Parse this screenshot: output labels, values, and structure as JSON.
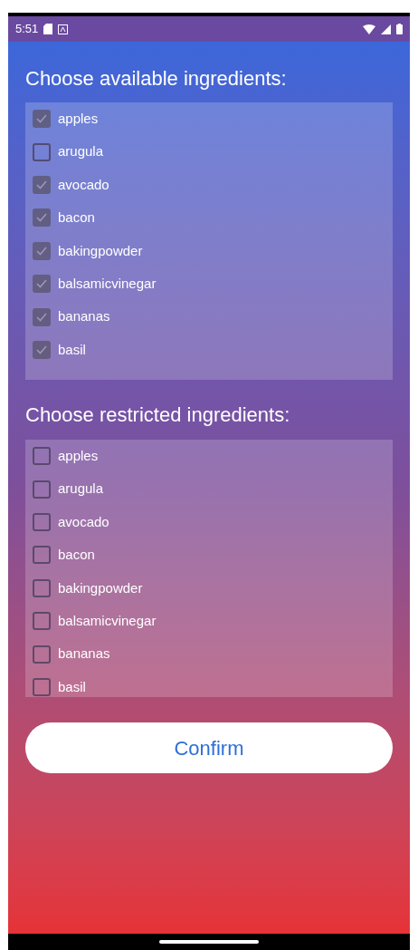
{
  "status_bar": {
    "time": "5:51"
  },
  "sections": [
    {
      "title": "Choose available ingredients:",
      "items": [
        {
          "label": "apples",
          "checked": true
        },
        {
          "label": "arugula",
          "checked": false
        },
        {
          "label": "avocado",
          "checked": true
        },
        {
          "label": "bacon",
          "checked": true
        },
        {
          "label": "bakingpowder",
          "checked": true
        },
        {
          "label": "balsamicvinegar",
          "checked": true
        },
        {
          "label": "bananas",
          "checked": true
        },
        {
          "label": "basil",
          "checked": true
        }
      ]
    },
    {
      "title": "Choose restricted ingredients:",
      "items": [
        {
          "label": "apples",
          "checked": false
        },
        {
          "label": "arugula",
          "checked": false
        },
        {
          "label": "avocado",
          "checked": false
        },
        {
          "label": "bacon",
          "checked": false
        },
        {
          "label": "bakingpowder",
          "checked": false
        },
        {
          "label": "balsamicvinegar",
          "checked": false
        },
        {
          "label": "bananas",
          "checked": false
        },
        {
          "label": "basil",
          "checked": false
        }
      ]
    }
  ],
  "confirm_button": "Confirm"
}
